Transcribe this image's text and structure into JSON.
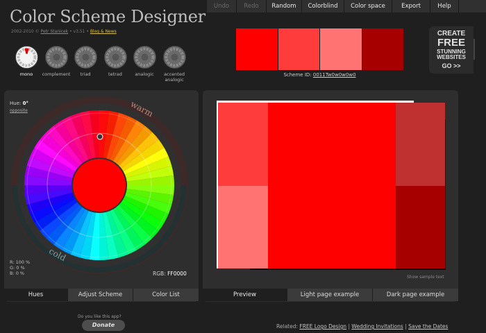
{
  "menu": [
    {
      "label": "Undo",
      "enabled": false
    },
    {
      "label": "Redo",
      "enabled": false
    },
    {
      "label": "Random",
      "enabled": true
    },
    {
      "label": "Colorblind",
      "enabled": true
    },
    {
      "label": "Color space",
      "enabled": true
    },
    {
      "label": "Export",
      "enabled": true
    },
    {
      "label": "Help",
      "enabled": true
    }
  ],
  "app": {
    "title": "Color Scheme Designer",
    "copyright": "2002-2010 ©",
    "author": "Petr Stanicek",
    "version": "• v3.51 •",
    "blog": "Blog & News"
  },
  "scheme_types": [
    {
      "label": "mono",
      "selected": true
    },
    {
      "label": "complement",
      "selected": false
    },
    {
      "label": "triad",
      "selected": false
    },
    {
      "label": "tetrad",
      "selected": false
    },
    {
      "label": "analogic",
      "selected": false
    },
    {
      "label": "accented analogic",
      "selected": false
    }
  ],
  "swatches": [
    "#ff0000",
    "#ff3c3c",
    "#ff7373",
    "#a60000"
  ],
  "scheme_id": {
    "label": "Scheme ID:",
    "value": "0011Tw0w0w0w0"
  },
  "ad": {
    "line1": "CREATE",
    "line2": "FREE",
    "line3": "STUNNING",
    "line4": "WEBSITES",
    "line5": "GO >>"
  },
  "wheel": {
    "hue_label": "Hue:",
    "hue_value": "0°",
    "opposite": "opposite",
    "warm": "warm",
    "cold": "cold",
    "center_color": "#ff0000",
    "rgb_r": "R: 100 %",
    "rgb_g": "G:    0 %",
    "rgb_b": "B:    0 %",
    "rgb_label": "RGB:",
    "rgb_hex": "FF0000"
  },
  "left_tabs": [
    {
      "label": "Hues",
      "active": true
    },
    {
      "label": "Adjust Scheme",
      "active": false
    },
    {
      "label": "Color List",
      "active": false
    }
  ],
  "right_tabs": [
    {
      "label": "Preview",
      "active": true
    },
    {
      "label": "Light page example",
      "active": false
    },
    {
      "label": "Dark page example",
      "active": false
    }
  ],
  "preview": {
    "colors": {
      "primary": "#ff0000",
      "light1": "#ff3c3c",
      "light2": "#ff7373",
      "dark1": "#bf3030",
      "dark2": "#a60000"
    },
    "show_sample": "Show sample text"
  },
  "footer": {
    "donate_question": "Do you like this app?",
    "donate": "Donate",
    "related_label": "Related:",
    "related_links": [
      "FREE Logo Design",
      "Wedding Invitations",
      "Save the Dates"
    ],
    "separator": "|"
  }
}
